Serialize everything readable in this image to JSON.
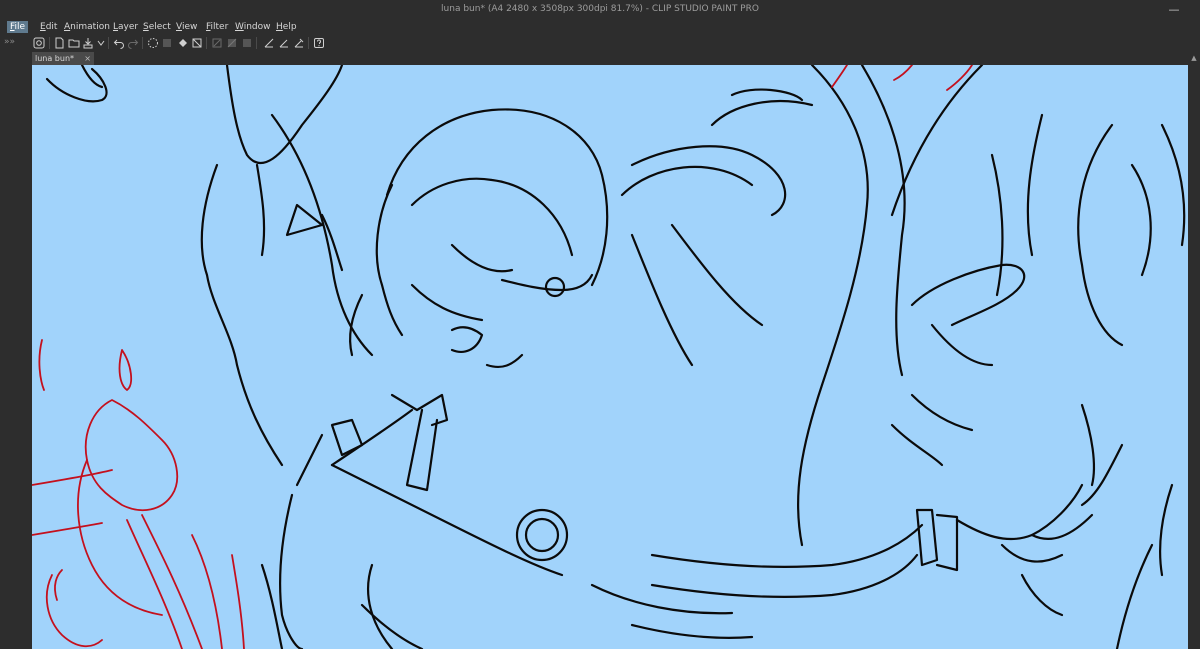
{
  "window": {
    "title": "luna bun* (A4 2480 x 3508px 300dpi 81.7%) - CLIP STUDIO PAINT PRO",
    "minimize_glyph": "—"
  },
  "menu": [
    {
      "label": "File",
      "underline": "F",
      "rest": "ile"
    },
    {
      "label": "Edit",
      "underline": "E",
      "rest": "dit"
    },
    {
      "label": "Animation",
      "underline": "A",
      "rest": "nimation"
    },
    {
      "label": "Layer",
      "underline": "L",
      "rest": "ayer"
    },
    {
      "label": "Select",
      "underline": "S",
      "rest": "elect"
    },
    {
      "label": "View",
      "underline": "V",
      "rest": "iew"
    },
    {
      "label": "Filter",
      "underline": "F",
      "rest": "ilter"
    },
    {
      "label": "Window",
      "underline": "W",
      "rest": "indow"
    },
    {
      "label": "Help",
      "underline": "H",
      "rest": "elp"
    }
  ],
  "toolbar": {
    "icons": [
      "clip-studio-icon",
      "new-icon",
      "open-icon",
      "save-icon",
      "export-icon",
      "undo-icon",
      "redo-icon",
      "clear-icon",
      "fill-icon",
      "transform-icon",
      "deselect-icon",
      "invert-selection-icon",
      "show-selection-icon",
      "ruler-icon",
      "snap-ruler-icon",
      "snap-grid-icon",
      "help-icon"
    ]
  },
  "sidebar": {
    "collapse_glyph": "»»"
  },
  "document_tab": {
    "label": "luna bun*",
    "close_glyph": "×"
  },
  "canvas": {
    "background": "#a1d3fb",
    "line_color": "#0b0b0b",
    "sketch_color": "#c4101d"
  }
}
